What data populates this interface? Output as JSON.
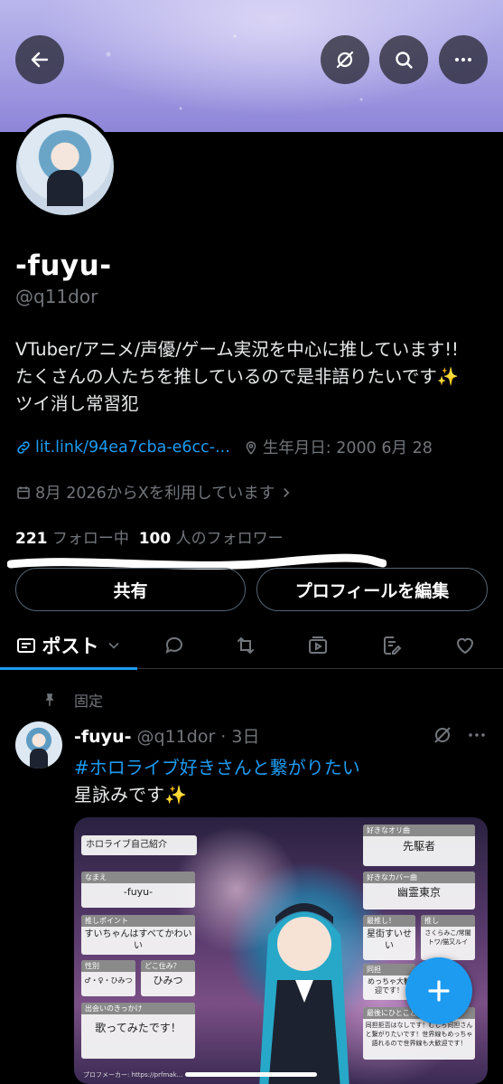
{
  "header": {
    "back_icon": "arrow-left-icon",
    "grok_icon": "grok-icon",
    "search_icon": "search-icon",
    "more_icon": "more-horizontal-icon"
  },
  "profile": {
    "display_name": "-fuyu-",
    "handle": "@q11dor",
    "bio_lines": [
      "VTuber/アニメ/声優/ゲーム実況を中心に推しています!!",
      "たくさんの人たちを推しているので是非語りたいです✨",
      "ツイ消し常習犯"
    ],
    "link": "lit.link/94ea7cba-e6cc-...",
    "birthday": "生年月日: 2000 6月 28",
    "joined": "8月 2026からXを利用しています",
    "following_count": "221",
    "following_label": "フォロー中",
    "followers_count": "100",
    "followers_label": "人のフォロワー"
  },
  "buttons": {
    "share": "共有",
    "edit_profile": "プロフィールを編集"
  },
  "tabs": {
    "posts": "ポスト"
  },
  "post": {
    "pinned_label": "固定",
    "author": "-fuyu-",
    "handle_time": "@q11dor · 3日",
    "hashtag": "#ホロライブ好きさんと繋がりたい",
    "text": "星詠みです✨"
  },
  "card": {
    "title": "ホロライブ自己紹介",
    "name_hdr": "なまえ",
    "name_val": "-fuyu-",
    "point_hdr": "推しポイント",
    "point_val": "すいちゃんはすべてかわいい",
    "gender_hdr": "性別",
    "gender_val": "♂・♀・ひみつ",
    "where_hdr": "どこ住み？",
    "where_val": "ひみつ",
    "meet_hdr": "出会いのきっかけ",
    "meet_val": "歌ってみたです！",
    "fav_orig_hdr": "好きなオリ曲",
    "fav_orig_val": "先駆者",
    "fav_cover_hdr": "好きなカバー曲",
    "fav_cover_val": "幽霊東京",
    "saioshi_hdr": "最推し！",
    "saioshi_val": "星街すいせい",
    "oshi_hdr": "推し",
    "oshi_val": "さくらみこ/常闇トワ/猫又ルイ",
    "ganbo_hdr": "同担",
    "ganbo_val": "めっちゃ大歓迎です！",
    "last_hdr": "最後にひとこと",
    "last_val": "同担拒否はなしです！むしろ同担さんと繋がりたいです！世界線もめっちゃ語れるので世界線も大歓迎です！",
    "footer": "プロフメーカー: https://prfmak..."
  },
  "colors": {
    "accent": "#1d9bf0",
    "muted": "#71767b",
    "background": "#000000"
  }
}
